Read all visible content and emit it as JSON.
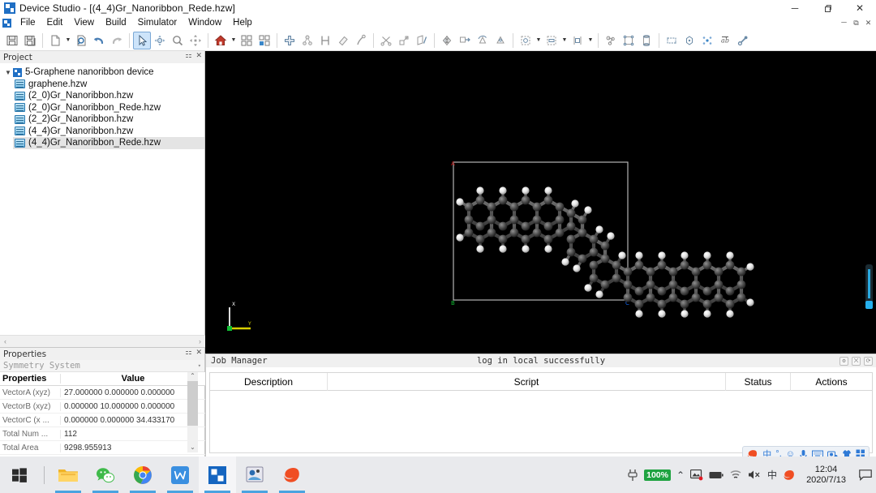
{
  "window": {
    "title": "Device Studio - [(4_4)Gr_Nanoribbon_Rede.hzw]",
    "app_icon": "device-studio-icon",
    "minimize": "─",
    "restore": "❐",
    "close": "✕",
    "mdi_minimize": "－",
    "mdi_restore": "⧉",
    "mdi_close": "✕"
  },
  "menu": {
    "items": [
      "File",
      "Edit",
      "View",
      "Build",
      "Simulator",
      "Window",
      "Help"
    ]
  },
  "toolbar": {
    "groups": [
      {
        "buttons": [
          {
            "name": "save-button",
            "icon": "save-icon"
          },
          {
            "name": "save-all-button",
            "icon": "save-all-icon"
          }
        ]
      },
      {
        "buttons": [
          {
            "name": "new-file-button",
            "icon": "new-document-icon",
            "caret": true
          },
          {
            "name": "open-file-button",
            "icon": "open-folder-icon"
          },
          {
            "name": "undo-button",
            "icon": "undo-arrow-icon"
          },
          {
            "name": "redo-button",
            "icon": "redo-arrow-icon"
          }
        ]
      },
      {
        "buttons": [
          {
            "name": "select-tool-button",
            "icon": "cursor-arrow-icon",
            "active": true
          },
          {
            "name": "rotate-tool-button",
            "icon": "rotate-icon"
          },
          {
            "name": "zoom-tool-button",
            "icon": "magnifier-icon"
          },
          {
            "name": "pan-tool-button",
            "icon": "move-cross-icon"
          }
        ]
      },
      {
        "buttons": [
          {
            "name": "home-view-button",
            "icon": "home-icon",
            "caret": true
          },
          {
            "name": "grid-view-button",
            "icon": "grid-four-icon"
          },
          {
            "name": "layout-view-button",
            "icon": "layout-panels-icon"
          }
        ]
      },
      {
        "buttons": [
          {
            "name": "add-atom-button",
            "icon": "plus-cross-icon"
          },
          {
            "name": "build-molecule-button",
            "icon": "molecule-icon"
          },
          {
            "name": "measure-button",
            "icon": "measure-icon"
          },
          {
            "name": "eraser-button",
            "icon": "eraser-icon"
          },
          {
            "name": "bond-tool-button",
            "icon": "bond-pen-icon"
          }
        ]
      },
      {
        "buttons": [
          {
            "name": "cut-button",
            "icon": "scissors-icon"
          },
          {
            "name": "cleave-surface-button",
            "icon": "cleave-icon"
          },
          {
            "name": "edit-lattice-button",
            "icon": "lattice-edit-icon"
          }
        ]
      },
      {
        "buttons": [
          {
            "name": "mirror-button",
            "icon": "mirror-icon"
          },
          {
            "name": "translate-button",
            "icon": "translate-icon"
          },
          {
            "name": "rotate-structure-button",
            "icon": "rotate-structure-icon"
          },
          {
            "name": "symmetry-button",
            "icon": "symmetry-icon"
          }
        ]
      },
      {
        "buttons": [
          {
            "name": "supercell-button",
            "icon": "supercell-icon",
            "caret": true
          },
          {
            "name": "slab-button",
            "icon": "slab-icon",
            "caret": true
          },
          {
            "name": "cell-box-button",
            "icon": "cell-box-icon",
            "caret": true
          }
        ]
      },
      {
        "buttons": [
          {
            "name": "cluster-button",
            "icon": "cluster-icon"
          },
          {
            "name": "crystal-button",
            "icon": "crystal-icon"
          },
          {
            "name": "nanotube-button",
            "icon": "nanotube-icon"
          }
        ]
      },
      {
        "buttons": [
          {
            "name": "device-region-button",
            "icon": "device-region-icon"
          },
          {
            "name": "electrode-button",
            "icon": "electrode-icon"
          },
          {
            "name": "scatter-region-button",
            "icon": "scatter-region-icon"
          },
          {
            "name": "label-button",
            "icon": "label-ab-icon"
          },
          {
            "name": "link-button",
            "icon": "link-chain-icon"
          }
        ]
      }
    ]
  },
  "project": {
    "caption": "Project",
    "pin_icon": "pin-icon",
    "close_icon": "close-icon",
    "root": {
      "label": "5-Graphene nanoribbon device",
      "expander": "▼",
      "icon": "project-folder-icon"
    },
    "files": [
      {
        "label": "graphene.hzw",
        "icon": "hzw-file-icon",
        "selected": false
      },
      {
        "label": "(2_0)Gr_Nanoribbon.hzw",
        "icon": "hzw-file-icon",
        "selected": false
      },
      {
        "label": "(2_0)Gr_Nanoribbon_Rede.hzw",
        "icon": "hzw-file-icon",
        "selected": false
      },
      {
        "label": "(2_2)Gr_Nanoribbon.hzw",
        "icon": "hzw-file-icon",
        "selected": false
      },
      {
        "label": "(4_4)Gr_Nanoribbon.hzw",
        "icon": "hzw-file-icon",
        "selected": false
      },
      {
        "label": "(4_4)Gr_Nanoribbon_Rede.hzw",
        "icon": "hzw-file-icon",
        "selected": true
      }
    ],
    "hscroll": {
      "left": "‹",
      "right": "›"
    }
  },
  "properties": {
    "caption": "Properties",
    "pin_icon": "pin-icon",
    "close_icon": "close-icon",
    "selector_value": "Symmetry System",
    "selector_caret": "▾",
    "columns": [
      "Properties",
      "Value"
    ],
    "rows": [
      {
        "name": "VectorA (xyz)",
        "value": "27.000000 0.000000 0.000000"
      },
      {
        "name": "VectorB (xyz)",
        "value": "0.000000 10.000000 0.000000"
      },
      {
        "name": "VectorC (x ...",
        "value": "0.000000 0.000000 34.433170"
      },
      {
        "name": "Total Num ...",
        "value": "112"
      },
      {
        "name": "Total Area",
        "value": "9298.955913"
      }
    ],
    "scroll_up": "⌃",
    "scroll_down": "⌄"
  },
  "viewport": {
    "background": "#000000",
    "cell_border": "#b0b0b0",
    "corner_labels": [
      {
        "label": "A",
        "color": "#cc1111",
        "position": "top-left"
      },
      {
        "label": "B",
        "color": "#11bb33",
        "position": "bottom-left"
      },
      {
        "label": "C",
        "color": "#1166ee",
        "position": "bottom-right"
      }
    ],
    "axis_gizmo": {
      "vertical_label": "X",
      "horizontal_label": "Y",
      "vertical_color": "#d8d8d8",
      "horizontal_color": "#d8d000",
      "origin_color": "#11bb33"
    },
    "structure": {
      "name": "graphene-nanoribbon",
      "carbon_color": "#4a4a4a",
      "hydrogen_color": "#f2f2f2"
    },
    "slider": {
      "name": "perspective-slider",
      "color": "#26b0ee"
    }
  },
  "job_manager": {
    "caption": "Job Manager",
    "status_message": "log in local successfully",
    "controls": [
      {
        "name": "job-settings-icon",
        "glyph": "⚙"
      },
      {
        "name": "job-filter-icon",
        "glyph": "⨉"
      },
      {
        "name": "job-refresh-icon",
        "glyph": "⟳"
      }
    ],
    "columns": [
      "Description",
      "Script",
      "Status",
      "Actions"
    ],
    "rows": []
  },
  "ime_bar": {
    "items": [
      {
        "name": "sogou-logo-icon",
        "glyph": "S"
      },
      {
        "name": "chinese-mode-icon",
        "glyph": "中"
      },
      {
        "name": "punctuation-icon",
        "glyph": "°,"
      },
      {
        "name": "emoji-icon",
        "glyph": "☺"
      },
      {
        "name": "voice-input-icon",
        "glyph": "🎤"
      },
      {
        "name": "soft-keyboard-icon",
        "glyph": "⌨"
      },
      {
        "name": "screenshot-icon",
        "glyph": "⬚"
      },
      {
        "name": "skin-icon",
        "glyph": "👕"
      },
      {
        "name": "toolbox-icon",
        "glyph": "⊞"
      }
    ]
  },
  "taskbar": {
    "start": {
      "name": "start-button",
      "icon": "windows-logo-icon"
    },
    "items": [
      {
        "name": "taskbar-file-explorer",
        "icon": "folder-icon",
        "active": false
      },
      {
        "name": "taskbar-wechat",
        "icon": "wechat-icon",
        "active": false
      },
      {
        "name": "taskbar-chrome",
        "icon": "chrome-icon",
        "active": false
      },
      {
        "name": "taskbar-wps",
        "icon": "wps-writer-icon",
        "active": false
      },
      {
        "name": "taskbar-device-studio",
        "icon": "device-studio-icon",
        "active": true
      },
      {
        "name": "taskbar-app-6",
        "icon": "app-window-icon",
        "active": false
      },
      {
        "name": "taskbar-sogou",
        "icon": "sogou-icon",
        "active": false
      }
    ],
    "tray": {
      "plug_icon": "power-plug-icon",
      "battery_level": "100%",
      "battery_color": "#1fa341",
      "chevron": "⌃",
      "icons": [
        {
          "name": "display-settings-icon",
          "glyph": "▣"
        },
        {
          "name": "battery-icon",
          "glyph": "▬"
        },
        {
          "name": "wifi-icon",
          "glyph": "◠"
        },
        {
          "name": "volume-muted-icon",
          "glyph": "🔇"
        },
        {
          "name": "ime-chinese-icon",
          "glyph": "中"
        },
        {
          "name": "sogou-tray-icon",
          "glyph": "S"
        }
      ],
      "time": "12:04",
      "date": "2020/7/13",
      "notification_icon": "notification-square-icon"
    }
  }
}
